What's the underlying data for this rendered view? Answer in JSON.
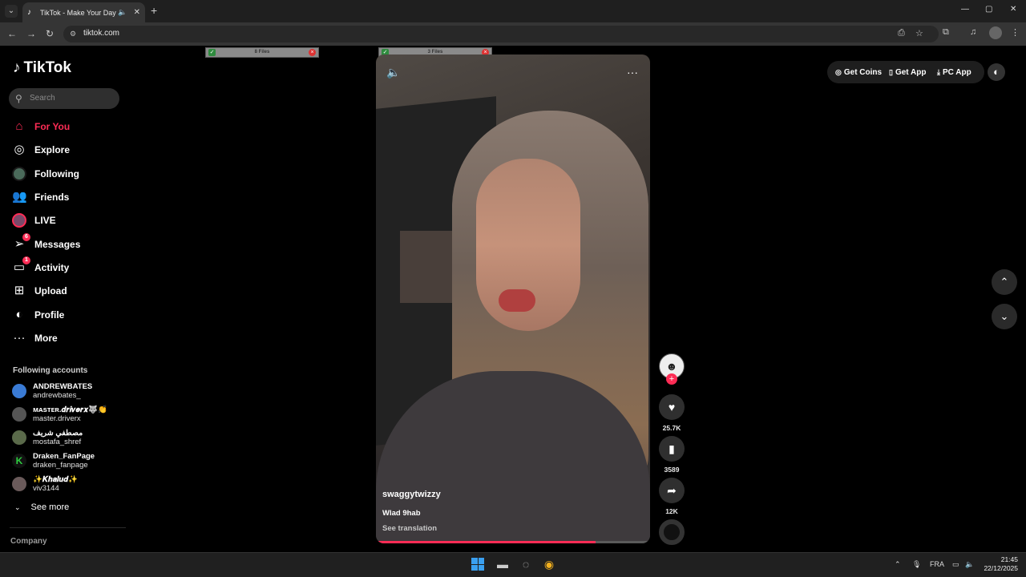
{
  "browser": {
    "tab_title": "TikTok - Make Your Day",
    "url": "tiktok.com"
  },
  "sidebar": {
    "logo": "TikTok",
    "search_placeholder": "Search",
    "nav": [
      {
        "label": "For You",
        "icon": "home-icon",
        "active": true
      },
      {
        "label": "Explore",
        "icon": "compass-icon"
      },
      {
        "label": "Following",
        "icon": "avatar"
      },
      {
        "label": "Friends",
        "icon": "friends-icon"
      },
      {
        "label": "LIVE",
        "icon": "live-avatar"
      },
      {
        "label": "Messages",
        "icon": "send-icon",
        "badge": "6"
      },
      {
        "label": "Activity",
        "icon": "inbox-icon",
        "badge": "1"
      },
      {
        "label": "Upload",
        "icon": "plus-square-icon"
      },
      {
        "label": "Profile",
        "icon": "profile-icon"
      },
      {
        "label": "More",
        "icon": "more-icon"
      }
    ],
    "following_title": "Following accounts",
    "accounts": [
      {
        "name": "ANDREWBATES",
        "handle": "andrewbates_",
        "color": "#3a7bd5"
      },
      {
        "name": "ᴍᴀsᴛᴇʀ.𝒅𝒓𝒊𝒗𝒆𝒓𝒙🐺👏",
        "handle": "master.driverx",
        "color": "#555555"
      },
      {
        "name": "مصطفي شريف",
        "handle": "mostafa_shref",
        "color": "#5a6a4a"
      },
      {
        "name": "Draken_FanPage",
        "handle": "draken_fanpage",
        "color": "#111111"
      },
      {
        "name": "✨𝑲𝒉𝒂𝒍𝒖𝒅✨",
        "handle": "viv3144",
        "color": "#6a5a5a"
      }
    ],
    "see_more": "See more",
    "company": "Company"
  },
  "file_widgets": [
    {
      "label": "8 Files"
    },
    {
      "label": "3 Files"
    }
  ],
  "video": {
    "username": "swaggytwizzy",
    "description": "Wlad 9hab",
    "see_translation": "See translation",
    "progress": 0.8
  },
  "actions": {
    "likes": "25.7K",
    "saves": "3589",
    "shares": "12K"
  },
  "topbar": {
    "get_coins": "Get Coins",
    "get_app": "Get App",
    "pc_app": "PC App"
  },
  "taskbar": {
    "lang": "FRA",
    "time": "21:45",
    "date": "22/12/2025"
  }
}
